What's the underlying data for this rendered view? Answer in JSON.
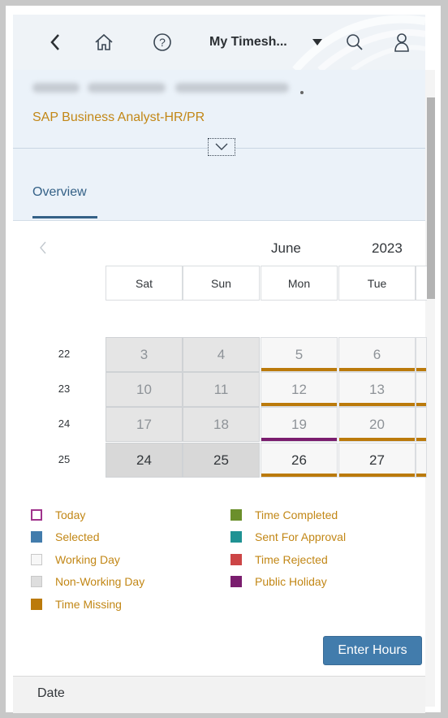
{
  "shell": {
    "title": "My Timesh...",
    "icons": [
      "back-icon",
      "home-icon",
      "help-icon",
      "caret-down-icon",
      "search-icon",
      "user-icon"
    ]
  },
  "header": {
    "subtitle": "SAP Business Analyst-HR/PR",
    "collapse_icon": "chevron-down-icon"
  },
  "tabs": [
    {
      "label": "Overview"
    }
  ],
  "calendar": {
    "month": "June",
    "year": "2023",
    "day_headers": [
      "Sat",
      "Sun",
      "Mon",
      "Tue"
    ],
    "weeks": [
      {
        "number": "22",
        "days": [
          {
            "label": "3",
            "type": "nonwork",
            "status": ""
          },
          {
            "label": "4",
            "type": "nonwork",
            "status": ""
          },
          {
            "label": "5",
            "type": "work",
            "status": "time-missing"
          },
          {
            "label": "6",
            "type": "work",
            "status": "time-missing"
          }
        ]
      },
      {
        "number": "23",
        "days": [
          {
            "label": "10",
            "type": "nonwork",
            "status": ""
          },
          {
            "label": "11",
            "type": "nonwork",
            "status": ""
          },
          {
            "label": "12",
            "type": "work",
            "status": "time-missing"
          },
          {
            "label": "13",
            "type": "work",
            "status": "time-missing"
          }
        ]
      },
      {
        "number": "24",
        "days": [
          {
            "label": "17",
            "type": "nonwork",
            "status": ""
          },
          {
            "label": "18",
            "type": "nonwork",
            "status": ""
          },
          {
            "label": "19",
            "type": "work",
            "status": "public-holiday"
          },
          {
            "label": "20",
            "type": "work",
            "status": "time-missing"
          }
        ]
      },
      {
        "number": "25",
        "days": [
          {
            "label": "24",
            "type": "nonwork",
            "status": "",
            "current": true
          },
          {
            "label": "25",
            "type": "nonwork",
            "status": "",
            "current": true
          },
          {
            "label": "26",
            "type": "work",
            "status": "time-missing",
            "current": true
          },
          {
            "label": "27",
            "type": "work",
            "status": "time-missing",
            "current": true
          }
        ]
      }
    ]
  },
  "legend": [
    {
      "label": "Today",
      "color": "#a0338c",
      "style": "outline"
    },
    {
      "label": "Selected",
      "color": "#427cac",
      "style": "fill"
    },
    {
      "label": "Working Day",
      "color": "#f7f7f7",
      "style": "fill"
    },
    {
      "label": "Non-Working Day",
      "color": "#dedede",
      "style": "fill"
    },
    {
      "label": "Time Missing",
      "color": "#bb7a0b",
      "style": "fill"
    },
    {
      "label": "Time Completed",
      "color": "#6b8f2b",
      "style": "fill"
    },
    {
      "label": "Sent For Approval",
      "color": "#1f9293",
      "style": "fill"
    },
    {
      "label": "Time Rejected",
      "color": "#cc4546",
      "style": "fill"
    },
    {
      "label": "Public Holiday",
      "color": "#7a1d6e",
      "style": "fill"
    }
  ],
  "status_colors": {
    "time-missing": "#bb7a0b",
    "public-holiday": "#7a1d6e"
  },
  "actions": {
    "enter_hours": "Enter Hours"
  },
  "footer": {
    "date_label": "Date"
  }
}
